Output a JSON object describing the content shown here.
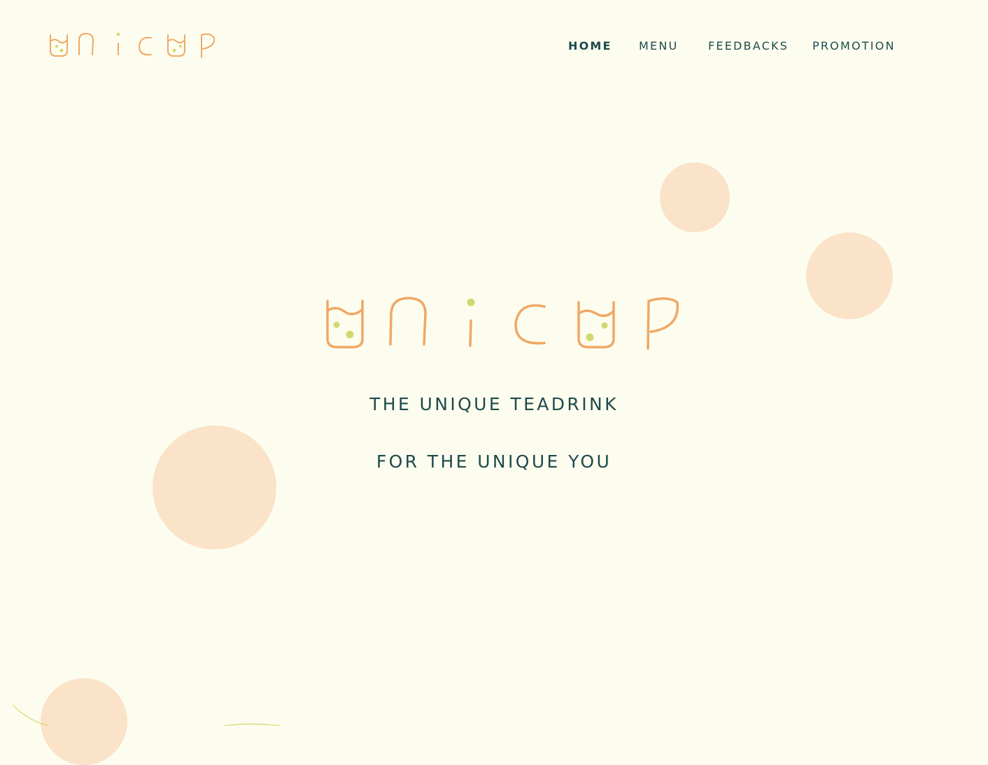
{
  "brand": {
    "name": "unicup",
    "colors": {
      "background": "#fdfdef",
      "accent": "#f0a865",
      "bubble": "#fae3c8",
      "dot": "#d3d86e",
      "text": "#1e4a4d"
    }
  },
  "nav": {
    "items": [
      {
        "label": "HOME",
        "active": true
      },
      {
        "label": "MENU",
        "active": false
      },
      {
        "label": "FEEDBACKS",
        "active": false
      },
      {
        "label": "PROMOTION",
        "active": false
      }
    ]
  },
  "hero": {
    "tagline_1": "THE UNIQUE TEADRINK",
    "tagline_2": "FOR THE UNIQUE YOU"
  }
}
